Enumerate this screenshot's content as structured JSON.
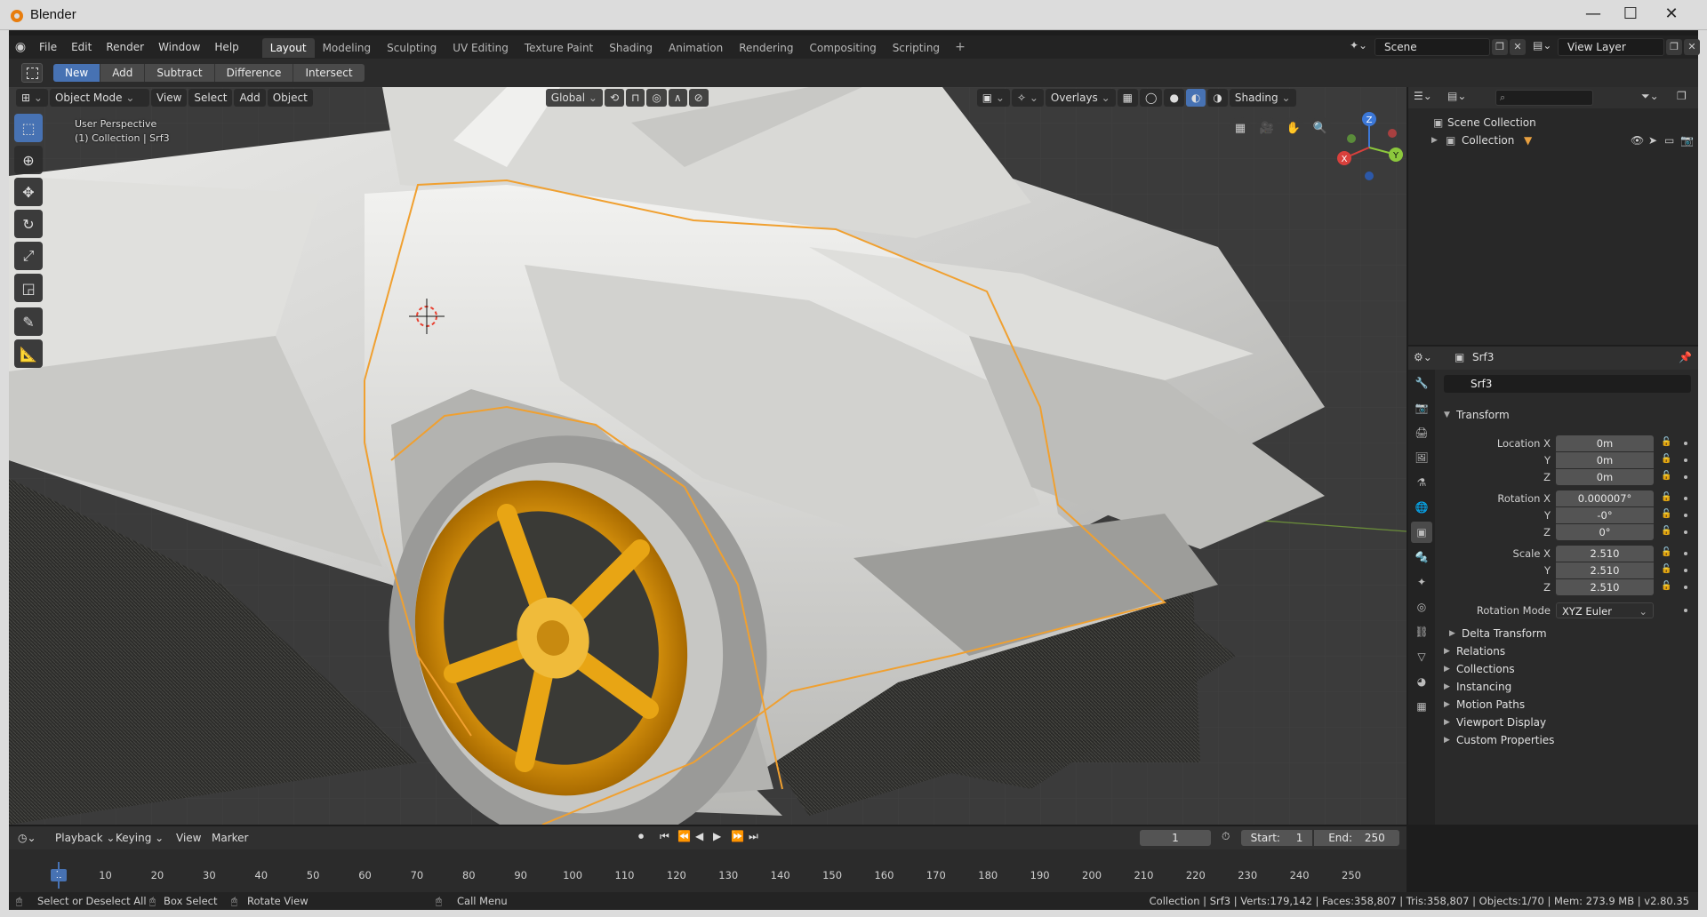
{
  "window": {
    "title": "Blender",
    "controls": [
      "—",
      "☐",
      "✕"
    ]
  },
  "topbar": {
    "menus": [
      "File",
      "Edit",
      "Render",
      "Window",
      "Help"
    ],
    "workspaces": [
      "Layout",
      "Modeling",
      "Sculpting",
      "UV Editing",
      "Texture Paint",
      "Shading",
      "Animation",
      "Rendering",
      "Compositing",
      "Scripting"
    ],
    "active_workspace": "Layout",
    "add_tab": "+",
    "scene": "Scene",
    "view_layer": "View Layer"
  },
  "toolheader": {
    "modes": [
      "New",
      "Add",
      "Subtract",
      "Difference",
      "Intersect"
    ],
    "active_mode": "New"
  },
  "viewport": {
    "mode": "Object Mode",
    "menus": [
      "View",
      "Select",
      "Add",
      "Object"
    ],
    "orientation": "Global",
    "overlays_label": "Overlays",
    "shading_label": "Shading",
    "info_line1": "User Perspective",
    "info_line2": "(1) Collection | Srf3",
    "gizmo_axes": {
      "x": "X",
      "y": "Y",
      "z": "Z"
    },
    "colors": {
      "selection_outline": "#f0a030",
      "rim_gold": "#e8a010",
      "body": "#d6d6d4",
      "axis_x": "#d8403c",
      "axis_y": "#8cc83c",
      "axis_z": "#3c78d8"
    }
  },
  "outliner": {
    "root": "Scene Collection",
    "items": [
      {
        "label": "Collection"
      }
    ]
  },
  "properties": {
    "object_header": "Srf3",
    "object_name": "Srf3",
    "transform_title": "Transform",
    "location": {
      "label": "Location X",
      "x": "0m",
      "y": "0m",
      "z": "0m"
    },
    "rotation": {
      "label": "Rotation X",
      "x": "0.000007°",
      "y": "-0°",
      "z": "0°"
    },
    "scale": {
      "label": "Scale X",
      "x": "2.510",
      "y": "2.510",
      "z": "2.510"
    },
    "axis_labels": {
      "y": "Y",
      "z": "Z"
    },
    "rotation_mode_label": "Rotation Mode",
    "rotation_mode_value": "XYZ Euler",
    "collapsed_panels": [
      "Delta Transform",
      "Relations",
      "Collections",
      "Instancing",
      "Motion Paths",
      "Viewport Display",
      "Custom Properties"
    ]
  },
  "timeline": {
    "menus": [
      "Playback",
      "Keying",
      "View",
      "Marker"
    ],
    "current_frame": "1",
    "start_label": "Start:",
    "start": "1",
    "end_label": "End:",
    "end": "250",
    "ticks": [
      "10",
      "20",
      "30",
      "40",
      "50",
      "60",
      "70",
      "80",
      "90",
      "100",
      "110",
      "120",
      "130",
      "140",
      "150",
      "160",
      "170",
      "180",
      "190",
      "200",
      "210",
      "220",
      "230",
      "240",
      "250"
    ],
    "playhead": "1"
  },
  "statusbar": {
    "select": "Select or Deselect All",
    "box": "Box Select",
    "rotate": "Rotate View",
    "call_menu": "Call Menu",
    "stats": "Collection | Srf3 | Verts:179,142 | Faces:358,807 | Tris:358,807 | Objects:1/70 | Mem: 273.9 MB | v2.80.35"
  }
}
